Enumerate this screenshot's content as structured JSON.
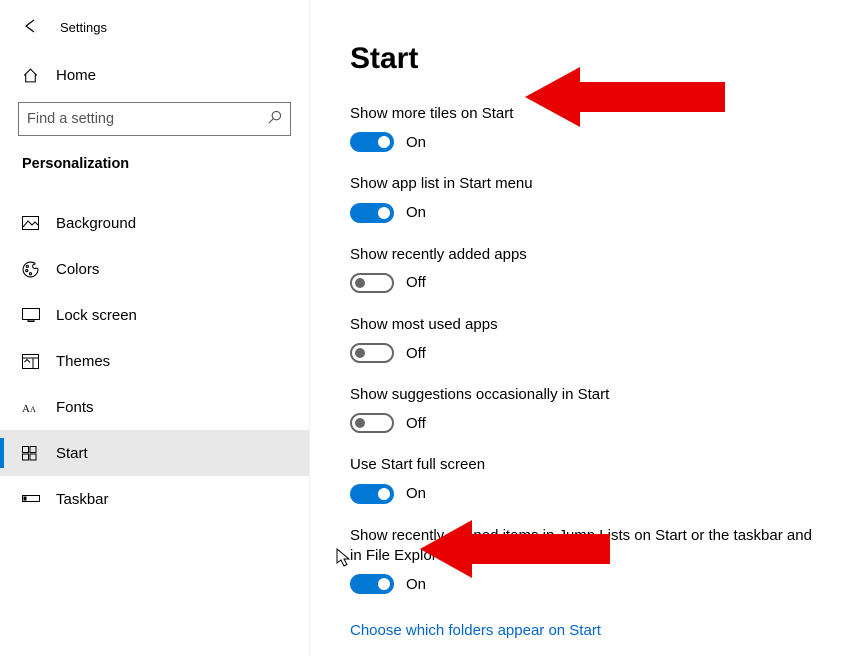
{
  "window": {
    "title": "Settings"
  },
  "sidebar": {
    "home_label": "Home",
    "search_placeholder": "Find a setting",
    "section_header": "Personalization",
    "nav": [
      "Background",
      "Colors",
      "Lock screen",
      "Themes",
      "Fonts",
      "Start",
      "Taskbar"
    ]
  },
  "page": {
    "title": "Start",
    "settings": [
      {
        "label": "Show more tiles on Start",
        "state_label": "On",
        "on": true
      },
      {
        "label": "Show app list in Start menu",
        "state_label": "On",
        "on": true
      },
      {
        "label": "Show recently added apps",
        "state_label": "Off",
        "on": false
      },
      {
        "label": "Show most used apps",
        "state_label": "Off",
        "on": false
      },
      {
        "label": "Show suggestions occasionally in Start",
        "state_label": "Off",
        "on": false
      },
      {
        "label": "Use Start full screen",
        "state_label": "On",
        "on": true
      },
      {
        "label": "Show recently opened items in Jump Lists on Start or the taskbar and in File Explorer Quick Access",
        "state_label": "On",
        "on": true
      }
    ],
    "link_text": "Choose which folders appear on Start"
  },
  "annotations": {
    "arrows": 2
  },
  "colors": {
    "accent": "#0078d4",
    "link": "#0066cc",
    "arrow": "#e60000"
  }
}
